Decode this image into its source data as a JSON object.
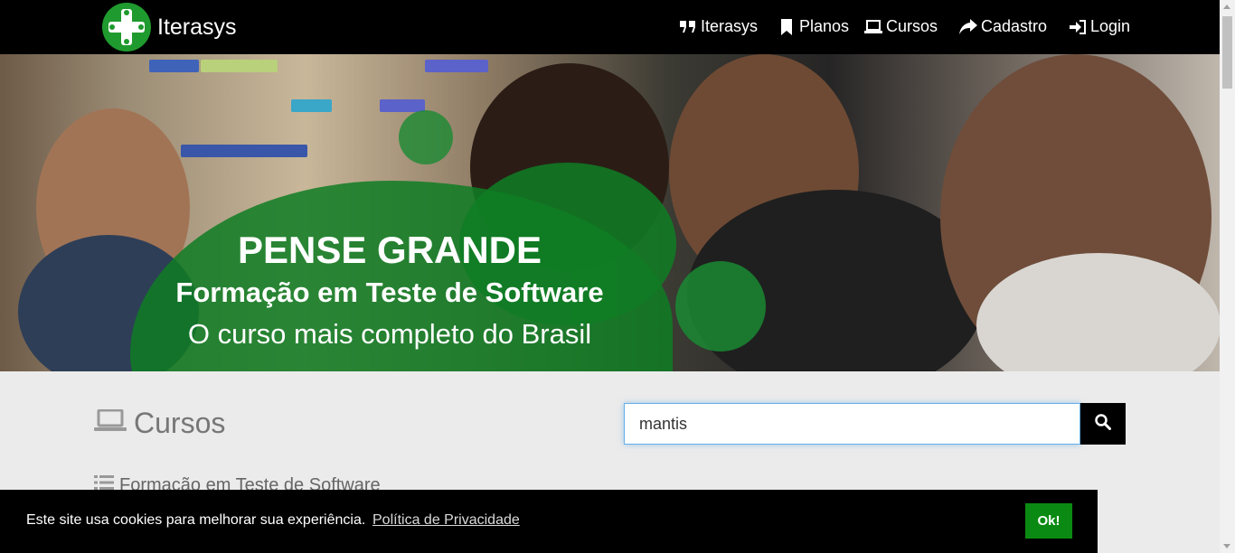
{
  "navbar": {
    "brand": "Iterasys",
    "logo_icon": "green-cross-logo-icon",
    "items": [
      {
        "label": "Iterasys",
        "icon": "quote-icon"
      },
      {
        "label": "Planos",
        "icon": "bookmark-icon"
      },
      {
        "label": "Cursos",
        "icon": "laptop-icon"
      },
      {
        "label": "Cadastro",
        "icon": "share-arrow-icon"
      },
      {
        "label": "Login",
        "icon": "sign-in-icon"
      }
    ]
  },
  "hero": {
    "title": "PENSE GRANDE",
    "subtitle": "Formação em Teste de Software",
    "tagline": "O curso mais completo do Brasil"
  },
  "courses": {
    "title": "Cursos",
    "icon": "laptop-icon",
    "search_value": "mantis",
    "search_icon": "search-icon",
    "subhead": "Formação em Teste de Software",
    "subhead_icon": "list-icon"
  },
  "cookie": {
    "message": "Este site usa cookies para melhorar sua experiência.",
    "link": "Política de Privacidade",
    "button": "Ok!"
  },
  "colors": {
    "navbar": "#000000",
    "brand_green": "#0f7d24",
    "cookie_button": "#0a8a12",
    "page_background": "#ebebeb"
  }
}
